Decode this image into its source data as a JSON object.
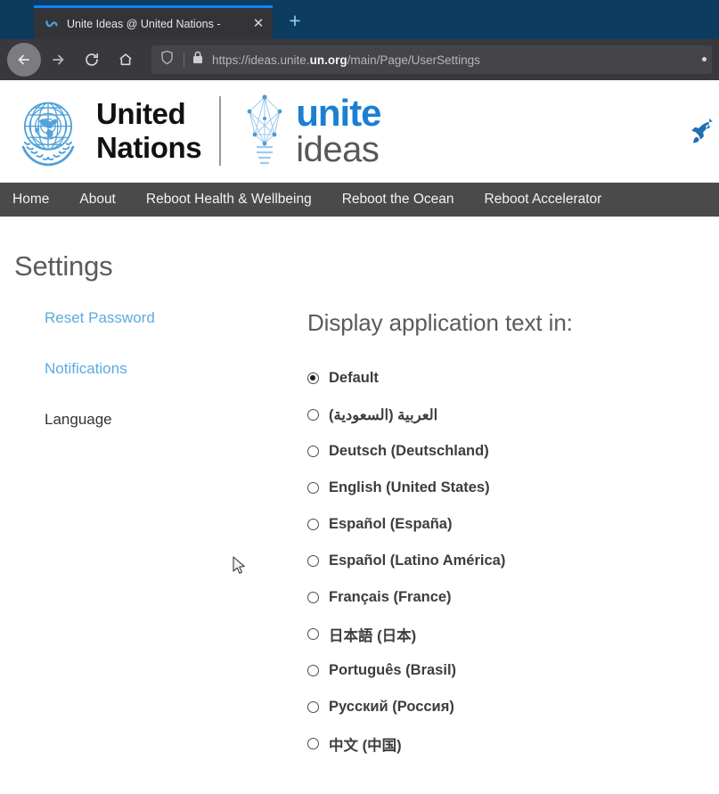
{
  "browser": {
    "tab": {
      "favicon": "unite-ideas-favicon",
      "title": "Unite Ideas @ United Nations -",
      "close_label": "✕"
    },
    "new_tab_label": "+",
    "toolbar": {
      "back_icon": "back-arrow-icon",
      "forward_icon": "forward-arrow-icon",
      "reload_icon": "reload-icon",
      "home_icon": "home-icon",
      "shield_icon": "tracking-protection-shield-icon",
      "lock_icon": "padlock-icon"
    },
    "url": {
      "prefix": "https://ideas.unite.",
      "domain": "un.org",
      "path": "/main/Page/UserSettings",
      "full": "https://ideas.unite.un.org/main/Page/UserSettings"
    }
  },
  "site_header": {
    "emblem_alt": "un-emblem-icon",
    "org_line_1": "United",
    "org_line_2": "Nations",
    "brand_primary": "unite",
    "brand_secondary": "ideas",
    "bulb_icon": "network-lightbulb-icon",
    "rocket_icon": "rocket-icon",
    "colors": {
      "un_blue": "#4f9fd8",
      "unite_blue": "#1b7fd4",
      "ideas_gray": "#58585b"
    }
  },
  "main_nav": {
    "items": [
      {
        "label": "Home"
      },
      {
        "label": "About"
      },
      {
        "label": "Reboot Health & Wellbeing"
      },
      {
        "label": "Reboot the Ocean"
      },
      {
        "label": "Reboot Accelerator"
      }
    ]
  },
  "page": {
    "title": "Settings"
  },
  "sidebar": {
    "items": [
      {
        "label": "Reset Password",
        "state": "link"
      },
      {
        "label": "Notifications",
        "state": "link"
      },
      {
        "label": "Language",
        "state": "active"
      }
    ]
  },
  "language_pane": {
    "heading": "Display application text in:",
    "options": [
      {
        "label": "Default",
        "selected": true,
        "rtl": false
      },
      {
        "label": "العربية (السعودية)",
        "selected": false,
        "rtl": true
      },
      {
        "label": "Deutsch (Deutschland)",
        "selected": false,
        "rtl": false
      },
      {
        "label": "English (United States)",
        "selected": false,
        "rtl": false
      },
      {
        "label": "Español (España)",
        "selected": false,
        "rtl": false
      },
      {
        "label": "Español (Latino América)",
        "selected": false,
        "rtl": false
      },
      {
        "label": "Français (France)",
        "selected": false,
        "rtl": false
      },
      {
        "label": "日本語 (日本)",
        "selected": false,
        "rtl": false
      },
      {
        "label": "Português (Brasil)",
        "selected": false,
        "rtl": false
      },
      {
        "label": "Русский (Россия)",
        "selected": false,
        "rtl": false
      },
      {
        "label": "中文 (中国)",
        "selected": false,
        "rtl": false
      }
    ]
  }
}
